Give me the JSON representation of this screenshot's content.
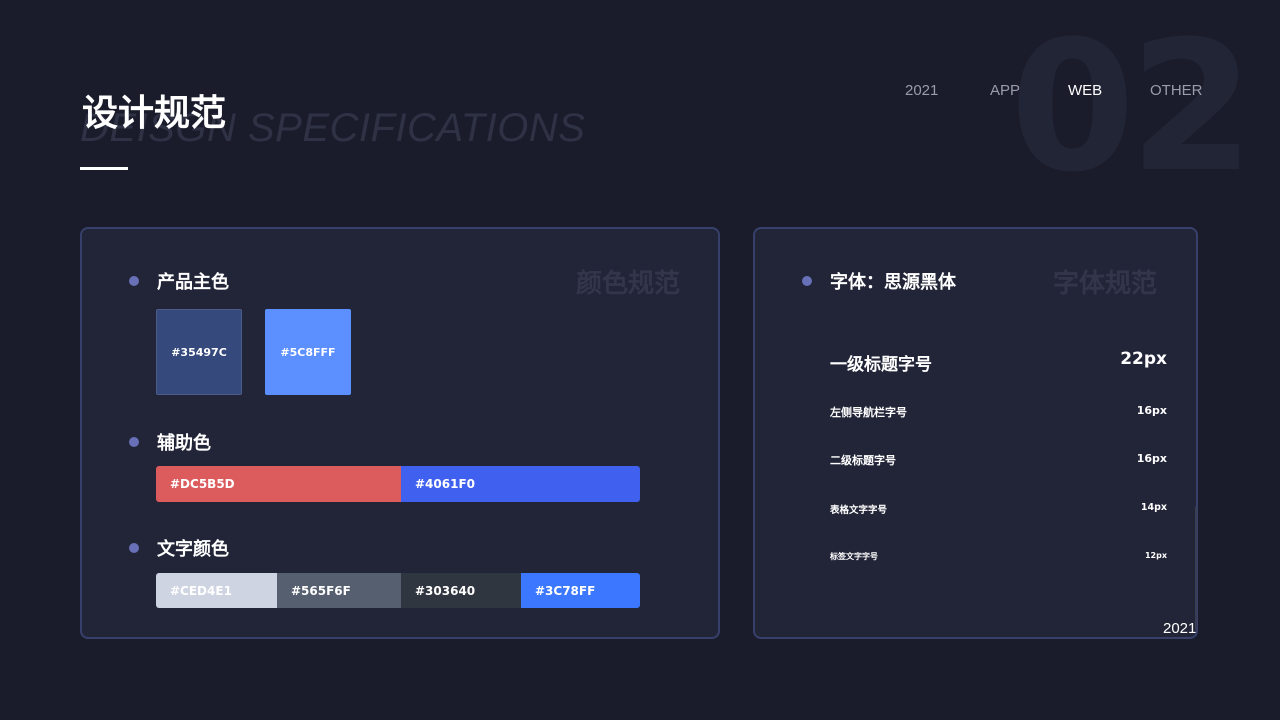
{
  "page": {
    "title": "设计规范",
    "subtitle": "DEISGN SPECIFICATIONS",
    "bg_number": "02",
    "footer_year": "2021"
  },
  "nav": {
    "items": [
      {
        "label": "2021"
      },
      {
        "label": "APP"
      },
      {
        "label": "WEB",
        "active": true
      },
      {
        "label": "OTHER"
      }
    ]
  },
  "colors_card": {
    "watermark": "颜色规范",
    "primary": {
      "label": "产品主色",
      "swatches": [
        {
          "hex": "#35497C"
        },
        {
          "hex": "#5C8FFF"
        }
      ]
    },
    "secondary": {
      "label": "辅助色",
      "swatches": [
        {
          "hex": "#DC5B5D"
        },
        {
          "hex": "#4061F0"
        }
      ]
    },
    "text": {
      "label": "文字颜色",
      "swatches": [
        {
          "hex": "#CED4E1"
        },
        {
          "hex": "#565F6F"
        },
        {
          "hex": "#303640"
        },
        {
          "hex": "#3C78FF"
        }
      ]
    }
  },
  "font_card": {
    "watermark": "字体规范",
    "font_label": "字体：思源黑体",
    "rows": [
      {
        "name": "一级标题字号",
        "size": "22px"
      },
      {
        "name": "左侧导航栏字号",
        "size": "16px"
      },
      {
        "name": "二级标题字号",
        "size": "16px"
      },
      {
        "name": "表格文字字号",
        "size": "14px"
      },
      {
        "name": "标签文字字号",
        "size": "12px"
      }
    ]
  }
}
